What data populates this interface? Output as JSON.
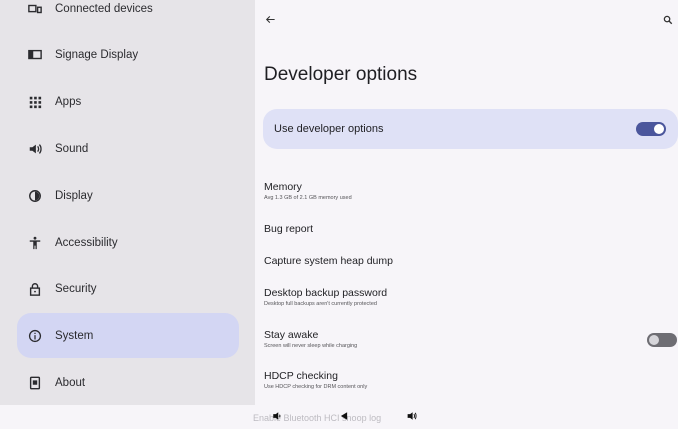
{
  "sidebar": {
    "items": [
      {
        "label": "Connected devices",
        "icon": "devices-icon",
        "selected": false
      },
      {
        "label": "Signage Display",
        "icon": "display-monitor-icon",
        "selected": false
      },
      {
        "label": "Apps",
        "icon": "apps-grid-icon",
        "selected": false
      },
      {
        "label": "Sound",
        "icon": "speaker-icon",
        "selected": false
      },
      {
        "label": "Display",
        "icon": "brightness-icon",
        "selected": false
      },
      {
        "label": "Accessibility",
        "icon": "accessibility-icon",
        "selected": false
      },
      {
        "label": "Security",
        "icon": "lock-icon",
        "selected": false
      },
      {
        "label": "System",
        "icon": "info-icon",
        "selected": true
      },
      {
        "label": "About",
        "icon": "tablet-icon",
        "selected": false
      }
    ]
  },
  "header": {
    "back_icon": "arrow-left-icon",
    "search_icon": "search-icon"
  },
  "main": {
    "title": "Developer options",
    "master": {
      "label": "Use developer options",
      "enabled": true
    },
    "settings": [
      {
        "title": "Memory",
        "summary": "Avg 1.3 GB of 2.1 GB memory used"
      },
      {
        "title": "Bug report",
        "summary": ""
      },
      {
        "title": "Capture system heap dump",
        "summary": ""
      },
      {
        "title": "Desktop backup password",
        "summary": "Desktop full backups aren't currently protected"
      },
      {
        "title": "Stay awake",
        "summary": "Screen will never sleep while charging",
        "toggle": false
      },
      {
        "title": "HDCP checking",
        "summary": "Use HDCP checking for DRM content only"
      }
    ]
  },
  "system_nav": {
    "obscured_text": "Enable Bluetooth HCI snoop log",
    "buttons": [
      "volume-down-icon",
      "back-triangle-icon",
      "volume-up-icon"
    ]
  },
  "colors": {
    "accent": "#4b569c",
    "selected_bg": "#d3d6f3",
    "master_bg": "#dfe1f6"
  }
}
